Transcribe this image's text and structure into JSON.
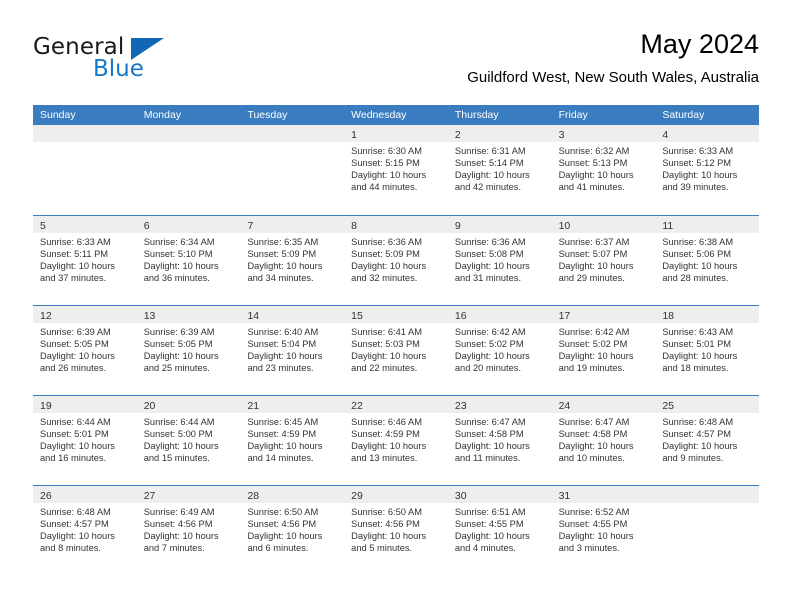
{
  "brand": {
    "name_part1": "General",
    "name_part2": "Blue",
    "triangle_color": "#1267b5",
    "blue_text_color": "#1878c8"
  },
  "header": {
    "title": "May 2024",
    "subtitle": "Guildford West, New South Wales, Australia"
  },
  "theme": {
    "header_bar_color": "#3a7cc0",
    "day_band_color": "#eeeeee",
    "text_color": "#333333"
  },
  "weekdays": [
    "Sunday",
    "Monday",
    "Tuesday",
    "Wednesday",
    "Thursday",
    "Friday",
    "Saturday"
  ],
  "weeks": [
    [
      {
        "day": "",
        "empty": true
      },
      {
        "day": "",
        "empty": true
      },
      {
        "day": "",
        "empty": true
      },
      {
        "day": "1",
        "sunrise": "Sunrise: 6:30 AM",
        "sunset": "Sunset: 5:15 PM",
        "daylight_line1": "Daylight: 10 hours",
        "daylight_line2": "and 44 minutes."
      },
      {
        "day": "2",
        "sunrise": "Sunrise: 6:31 AM",
        "sunset": "Sunset: 5:14 PM",
        "daylight_line1": "Daylight: 10 hours",
        "daylight_line2": "and 42 minutes."
      },
      {
        "day": "3",
        "sunrise": "Sunrise: 6:32 AM",
        "sunset": "Sunset: 5:13 PM",
        "daylight_line1": "Daylight: 10 hours",
        "daylight_line2": "and 41 minutes."
      },
      {
        "day": "4",
        "sunrise": "Sunrise: 6:33 AM",
        "sunset": "Sunset: 5:12 PM",
        "daylight_line1": "Daylight: 10 hours",
        "daylight_line2": "and 39 minutes."
      }
    ],
    [
      {
        "day": "5",
        "sunrise": "Sunrise: 6:33 AM",
        "sunset": "Sunset: 5:11 PM",
        "daylight_line1": "Daylight: 10 hours",
        "daylight_line2": "and 37 minutes."
      },
      {
        "day": "6",
        "sunrise": "Sunrise: 6:34 AM",
        "sunset": "Sunset: 5:10 PM",
        "daylight_line1": "Daylight: 10 hours",
        "daylight_line2": "and 36 minutes."
      },
      {
        "day": "7",
        "sunrise": "Sunrise: 6:35 AM",
        "sunset": "Sunset: 5:09 PM",
        "daylight_line1": "Daylight: 10 hours",
        "daylight_line2": "and 34 minutes."
      },
      {
        "day": "8",
        "sunrise": "Sunrise: 6:36 AM",
        "sunset": "Sunset: 5:09 PM",
        "daylight_line1": "Daylight: 10 hours",
        "daylight_line2": "and 32 minutes."
      },
      {
        "day": "9",
        "sunrise": "Sunrise: 6:36 AM",
        "sunset": "Sunset: 5:08 PM",
        "daylight_line1": "Daylight: 10 hours",
        "daylight_line2": "and 31 minutes."
      },
      {
        "day": "10",
        "sunrise": "Sunrise: 6:37 AM",
        "sunset": "Sunset: 5:07 PM",
        "daylight_line1": "Daylight: 10 hours",
        "daylight_line2": "and 29 minutes."
      },
      {
        "day": "11",
        "sunrise": "Sunrise: 6:38 AM",
        "sunset": "Sunset: 5:06 PM",
        "daylight_line1": "Daylight: 10 hours",
        "daylight_line2": "and 28 minutes."
      }
    ],
    [
      {
        "day": "12",
        "sunrise": "Sunrise: 6:39 AM",
        "sunset": "Sunset: 5:05 PM",
        "daylight_line1": "Daylight: 10 hours",
        "daylight_line2": "and 26 minutes."
      },
      {
        "day": "13",
        "sunrise": "Sunrise: 6:39 AM",
        "sunset": "Sunset: 5:05 PM",
        "daylight_line1": "Daylight: 10 hours",
        "daylight_line2": "and 25 minutes."
      },
      {
        "day": "14",
        "sunrise": "Sunrise: 6:40 AM",
        "sunset": "Sunset: 5:04 PM",
        "daylight_line1": "Daylight: 10 hours",
        "daylight_line2": "and 23 minutes."
      },
      {
        "day": "15",
        "sunrise": "Sunrise: 6:41 AM",
        "sunset": "Sunset: 5:03 PM",
        "daylight_line1": "Daylight: 10 hours",
        "daylight_line2": "and 22 minutes."
      },
      {
        "day": "16",
        "sunrise": "Sunrise: 6:42 AM",
        "sunset": "Sunset: 5:02 PM",
        "daylight_line1": "Daylight: 10 hours",
        "daylight_line2": "and 20 minutes."
      },
      {
        "day": "17",
        "sunrise": "Sunrise: 6:42 AM",
        "sunset": "Sunset: 5:02 PM",
        "daylight_line1": "Daylight: 10 hours",
        "daylight_line2": "and 19 minutes."
      },
      {
        "day": "18",
        "sunrise": "Sunrise: 6:43 AM",
        "sunset": "Sunset: 5:01 PM",
        "daylight_line1": "Daylight: 10 hours",
        "daylight_line2": "and 18 minutes."
      }
    ],
    [
      {
        "day": "19",
        "sunrise": "Sunrise: 6:44 AM",
        "sunset": "Sunset: 5:01 PM",
        "daylight_line1": "Daylight: 10 hours",
        "daylight_line2": "and 16 minutes."
      },
      {
        "day": "20",
        "sunrise": "Sunrise: 6:44 AM",
        "sunset": "Sunset: 5:00 PM",
        "daylight_line1": "Daylight: 10 hours",
        "daylight_line2": "and 15 minutes."
      },
      {
        "day": "21",
        "sunrise": "Sunrise: 6:45 AM",
        "sunset": "Sunset: 4:59 PM",
        "daylight_line1": "Daylight: 10 hours",
        "daylight_line2": "and 14 minutes."
      },
      {
        "day": "22",
        "sunrise": "Sunrise: 6:46 AM",
        "sunset": "Sunset: 4:59 PM",
        "daylight_line1": "Daylight: 10 hours",
        "daylight_line2": "and 13 minutes."
      },
      {
        "day": "23",
        "sunrise": "Sunrise: 6:47 AM",
        "sunset": "Sunset: 4:58 PM",
        "daylight_line1": "Daylight: 10 hours",
        "daylight_line2": "and 11 minutes."
      },
      {
        "day": "24",
        "sunrise": "Sunrise: 6:47 AM",
        "sunset": "Sunset: 4:58 PM",
        "daylight_line1": "Daylight: 10 hours",
        "daylight_line2": "and 10 minutes."
      },
      {
        "day": "25",
        "sunrise": "Sunrise: 6:48 AM",
        "sunset": "Sunset: 4:57 PM",
        "daylight_line1": "Daylight: 10 hours",
        "daylight_line2": "and 9 minutes."
      }
    ],
    [
      {
        "day": "26",
        "sunrise": "Sunrise: 6:48 AM",
        "sunset": "Sunset: 4:57 PM",
        "daylight_line1": "Daylight: 10 hours",
        "daylight_line2": "and 8 minutes."
      },
      {
        "day": "27",
        "sunrise": "Sunrise: 6:49 AM",
        "sunset": "Sunset: 4:56 PM",
        "daylight_line1": "Daylight: 10 hours",
        "daylight_line2": "and 7 minutes."
      },
      {
        "day": "28",
        "sunrise": "Sunrise: 6:50 AM",
        "sunset": "Sunset: 4:56 PM",
        "daylight_line1": "Daylight: 10 hours",
        "daylight_line2": "and 6 minutes."
      },
      {
        "day": "29",
        "sunrise": "Sunrise: 6:50 AM",
        "sunset": "Sunset: 4:56 PM",
        "daylight_line1": "Daylight: 10 hours",
        "daylight_line2": "and 5 minutes."
      },
      {
        "day": "30",
        "sunrise": "Sunrise: 6:51 AM",
        "sunset": "Sunset: 4:55 PM",
        "daylight_line1": "Daylight: 10 hours",
        "daylight_line2": "and 4 minutes."
      },
      {
        "day": "31",
        "sunrise": "Sunrise: 6:52 AM",
        "sunset": "Sunset: 4:55 PM",
        "daylight_line1": "Daylight: 10 hours",
        "daylight_line2": "and 3 minutes."
      },
      {
        "day": "",
        "empty": true
      }
    ]
  ]
}
